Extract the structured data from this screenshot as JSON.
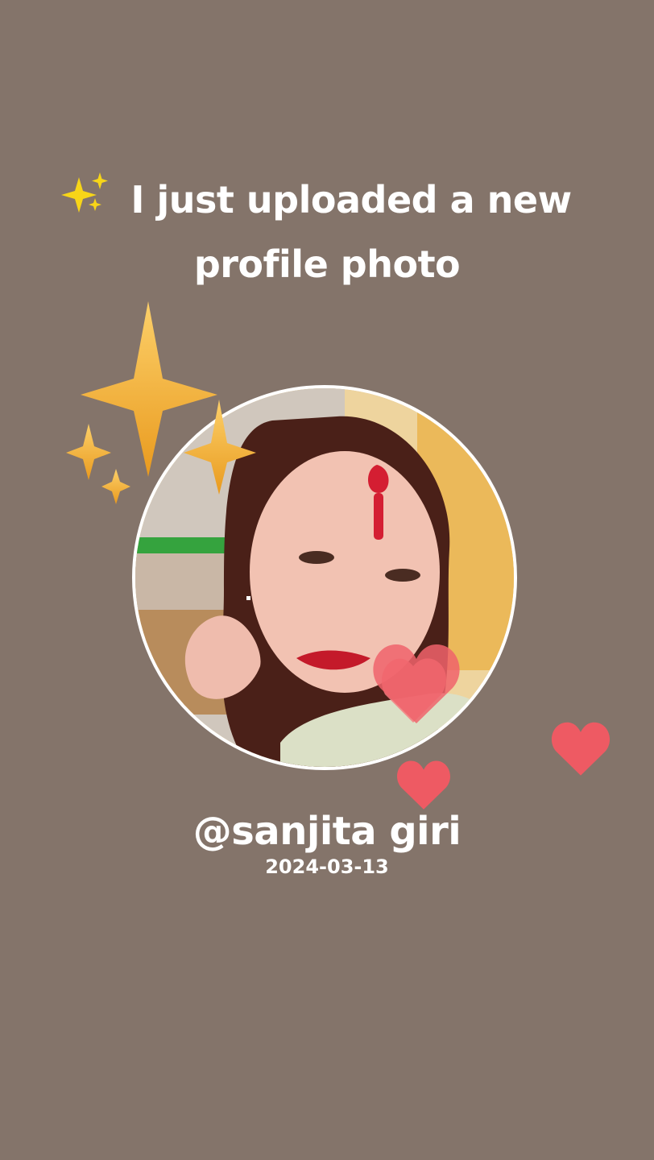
{
  "post": {
    "headline_line1": "I just uploaded a new",
    "headline_line2": "profile photo",
    "headline_emoji": "sparkles-icon",
    "username": "@sanjita giri",
    "date": "2024-03-13"
  },
  "decorations": {
    "sparkle_color": "#f4b43c",
    "heart_color": "#f0636b",
    "background_color": "#84746a"
  }
}
